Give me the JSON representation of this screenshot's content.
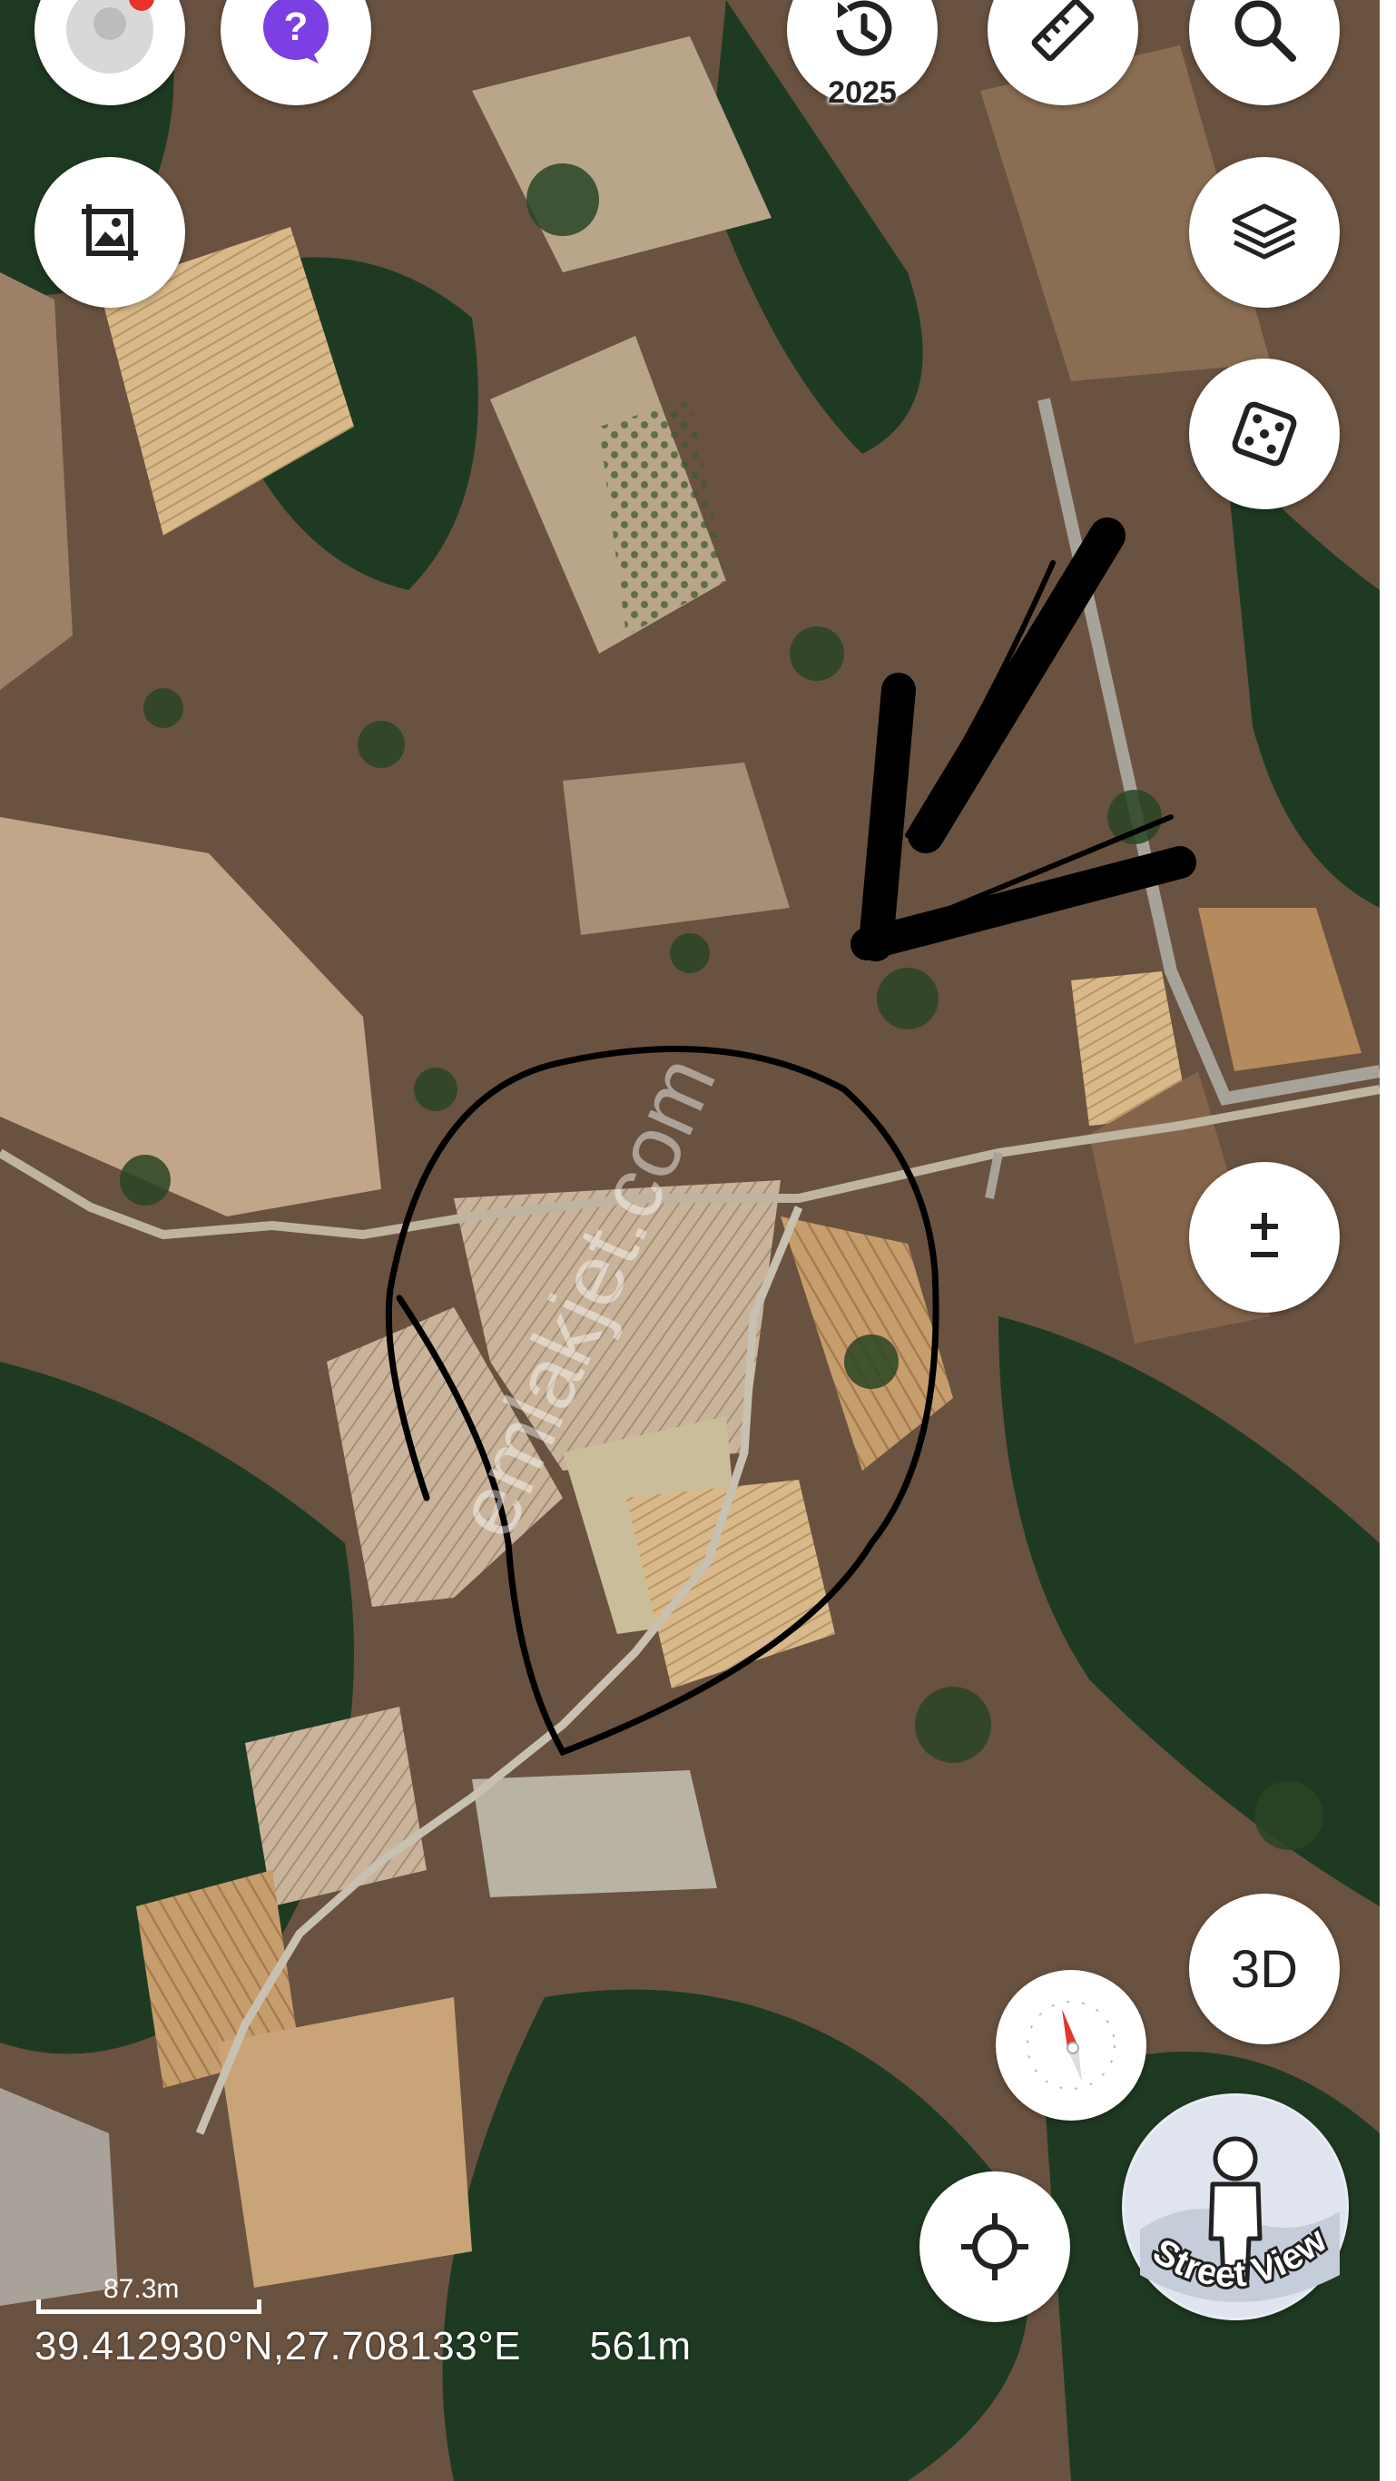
{
  "toolbar": {
    "historical_year": "2025"
  },
  "buttons": {
    "three_d_label": "3D",
    "street_view_label": "Street View"
  },
  "icons": {
    "profile": "profile-avatar-icon",
    "help": "question-chat-icon",
    "history": "history-clock-icon",
    "ruler": "ruler-icon",
    "search": "search-icon",
    "screenshot": "image-frame-icon",
    "layers": "layers-icon",
    "random": "dice-icon",
    "zoom": "plus-minus-icon",
    "compass": "compass-icon",
    "locate": "crosshair-icon",
    "street_view": "pegman-icon"
  },
  "status": {
    "scale_label": "87.3m",
    "coordinates": "39.412930°N,27.708133°E",
    "altitude": "561m"
  },
  "annotation": {
    "watermark": "emlakjet.com"
  },
  "colors": {
    "notification_dot": "#e8322b",
    "help_purple": "#7b3fe4",
    "compass_red": "#e03a2f"
  }
}
